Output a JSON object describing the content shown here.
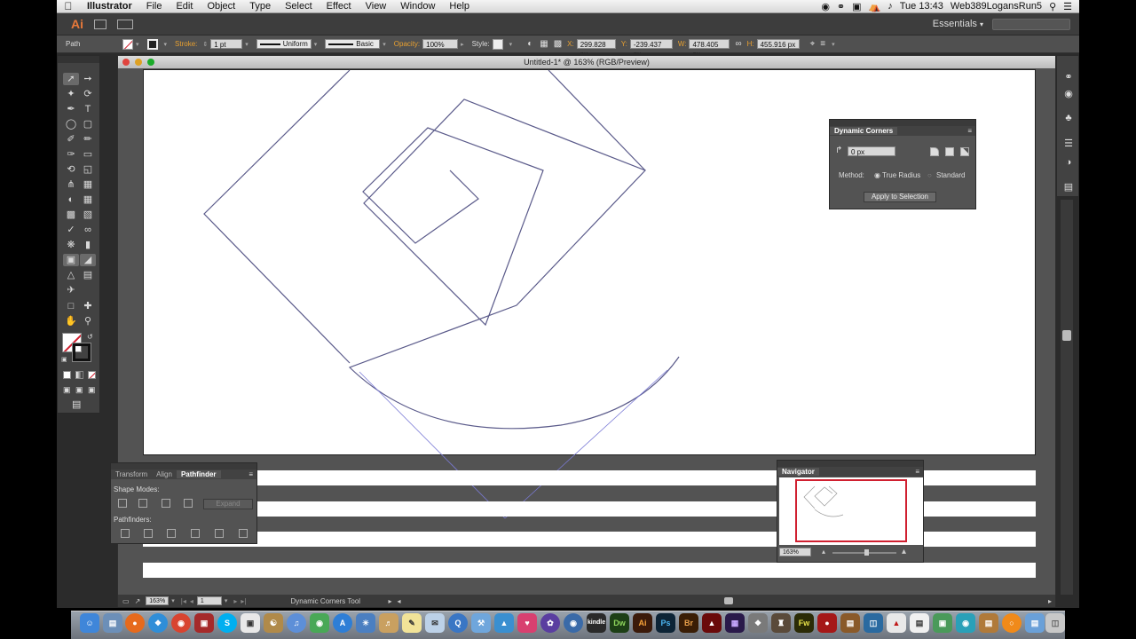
{
  "menubar": {
    "apple": "",
    "app_name": "Illustrator",
    "items": [
      "File",
      "Edit",
      "Object",
      "Type",
      "Select",
      "Effect",
      "View",
      "Window",
      "Help"
    ],
    "clock": "Tue 13:43",
    "user": "Web389LogansRun5"
  },
  "appbar": {
    "logo": "Ai",
    "workspace": "Essentials",
    "workspace_caret": "▾"
  },
  "controlbar": {
    "selection_type": "Path",
    "stroke_label": "Stroke:",
    "stroke_weight": "1 pt",
    "profile": "Uniform",
    "brush": "Basic",
    "opacity_label": "Opacity:",
    "opacity": "100%",
    "style_label": "Style:",
    "x_label": "X:",
    "x": "299.828 px",
    "y_label": "Y:",
    "y": "-239.437 px",
    "w_label": "W:",
    "w": "478.405 px",
    "h_label": "H:",
    "h": "455.916 px"
  },
  "document": {
    "title": "Untitled-1* @ 163% (RGB/Preview)",
    "zoom": "163%",
    "artboard_number": "1",
    "status_tool": "Dynamic Corners Tool"
  },
  "dynamic_corners": {
    "title": "Dynamic Corners",
    "radius": "0 px",
    "method_label": "Method:",
    "option_true_radius": "True Radius",
    "option_standard": "Standard",
    "selected_method": "True Radius",
    "apply_button": "Apply to Selection"
  },
  "pathfinder": {
    "tabs": [
      "Transform",
      "Align",
      "Pathfinder"
    ],
    "active_tab": "Pathfinder",
    "shape_modes_label": "Shape Modes:",
    "expand_button": "Expand",
    "pathfinders_label": "Pathfinders:"
  },
  "navigator": {
    "title": "Navigator",
    "zoom": "163%"
  },
  "colors": {
    "artwork_stroke": "#5a5a8a",
    "direction_handle": "#7b7bd6",
    "ai_orange": "#e8793a",
    "nav_view_box": "#d02030"
  },
  "icons": {
    "tools": [
      "selection-tool",
      "direct-selection-tool",
      "magic-wand-tool",
      "lasso-tool",
      "pen-tool",
      "type-tool",
      "line-segment-tool",
      "rectangle-tool",
      "paintbrush-tool",
      "pencil-tool",
      "blob-brush-tool",
      "eraser-tool",
      "rotate-tool",
      "scale-tool",
      "width-tool",
      "free-transform-tool",
      "shape-builder-tool",
      "perspective-grid-tool",
      "mesh-tool",
      "gradient-tool",
      "eyedropper-tool",
      "blend-tool",
      "symbol-sprayer-tool",
      "column-graph-tool",
      "artboard-tool",
      "slice-tool",
      "hand-tool",
      "zoom-tool"
    ],
    "dock_labels": [
      "Dw",
      "Ai",
      "Ps",
      "Br",
      "Fw",
      "kindle"
    ]
  }
}
